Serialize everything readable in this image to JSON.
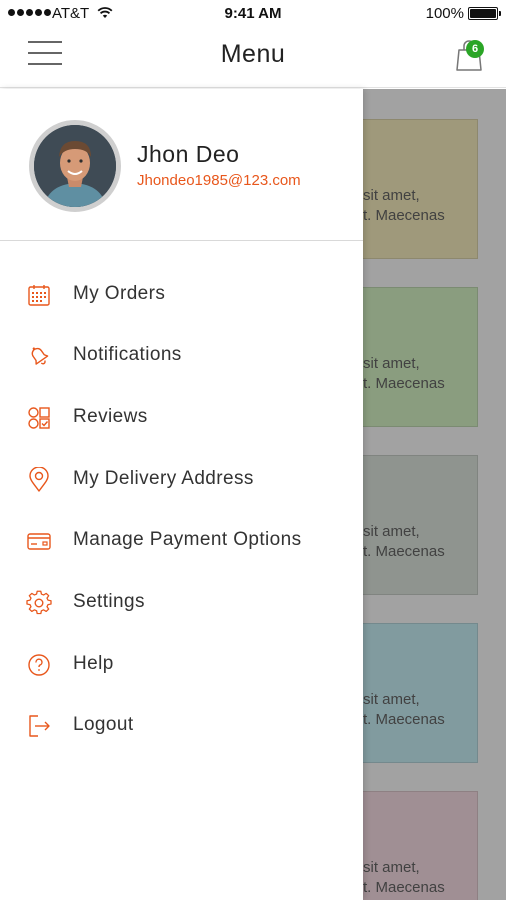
{
  "status_bar": {
    "carrier": "AT&T",
    "time": "9:41 AM",
    "battery": "100%"
  },
  "nav": {
    "title": "Menu",
    "cart_count": "6"
  },
  "profile": {
    "name": "Jhon Deo",
    "email": "Jhondeo1985@123.com"
  },
  "menu": {
    "items": [
      {
        "label": "My Orders",
        "icon": "calendar-icon"
      },
      {
        "label": "Notifications",
        "icon": "bell-icon"
      },
      {
        "label": "Reviews",
        "icon": "reviews-icon"
      },
      {
        "label": "My Delivery Address",
        "icon": "location-pin-icon"
      },
      {
        "label": "Manage Payment Options",
        "icon": "credit-card-icon"
      },
      {
        "label": "Settings",
        "icon": "gear-icon"
      },
      {
        "label": "Help",
        "icon": "help-icon"
      },
      {
        "label": "Logout",
        "icon": "logout-icon"
      }
    ]
  },
  "background_cards": [
    {
      "line1": "sit amet,",
      "line2": "t. Maecenas",
      "color": "#efe3a6"
    },
    {
      "line1": "sit amet,",
      "line2": "t. Maecenas",
      "color": "#c4eaae"
    },
    {
      "line1": "sit amet,",
      "line2": "t. Maecenas",
      "color": "#cfd9cf"
    },
    {
      "line1": "sit amet,",
      "line2": "t. Maecenas",
      "color": "#b3e6ee"
    },
    {
      "line1": "sit amet,",
      "line2": "t. Maecenas",
      "color": "#f0cfd8"
    }
  ],
  "colors": {
    "accent": "#e8571c",
    "badge": "#2aa526"
  }
}
